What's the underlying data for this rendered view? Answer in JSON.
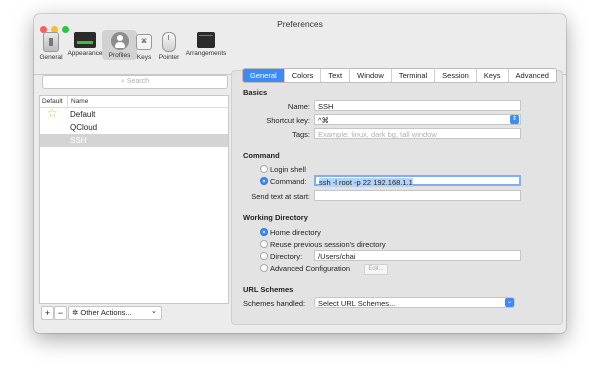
{
  "window": {
    "title": "Preferences"
  },
  "toolbar": {
    "items": [
      {
        "label": "General"
      },
      {
        "label": "Appearance"
      },
      {
        "label": "Profiles"
      },
      {
        "label": "Keys"
      },
      {
        "label": "Pointer"
      },
      {
        "label": "Arrangements"
      }
    ]
  },
  "profiles": {
    "search_placeholder": "Search",
    "col_default": "Default",
    "col_name": "Name",
    "rows": [
      {
        "name": "Default",
        "is_default": true
      },
      {
        "name": "QCloud",
        "is_default": false
      },
      {
        "name": "SSH",
        "is_default": false,
        "selected": true
      }
    ],
    "add_label": "+",
    "remove_label": "−",
    "other_actions_label": "Other Actions...",
    "other_actions_caret": "⌄",
    "gear": "✲"
  },
  "tabs": [
    {
      "label": "General",
      "active": true
    },
    {
      "label": "Colors"
    },
    {
      "label": "Text"
    },
    {
      "label": "Window"
    },
    {
      "label": "Terminal"
    },
    {
      "label": "Session"
    },
    {
      "label": "Keys"
    },
    {
      "label": "Advanced"
    }
  ],
  "basics": {
    "heading": "Basics",
    "name_label": "Name:",
    "name_value": "SSH",
    "shortcut_label": "Shortcut key:",
    "shortcut_value": "^⌘",
    "tags_label": "Tags:",
    "tags_placeholder": "Example: linux, dark bg, tall window"
  },
  "command": {
    "heading": "Command",
    "login_shell_label": "Login shell",
    "command_label": "Command:",
    "command_value": "ssh -l root -p 22 192.168.1.1",
    "send_text_label": "Send text at start:",
    "send_text_value": ""
  },
  "working_directory": {
    "heading": "Working Directory",
    "home_label": "Home directory",
    "reuse_label": "Reuse previous session's directory",
    "directory_label": "Directory:",
    "directory_value": "/Users/chai",
    "advanced_label": "Advanced Configuration",
    "edit_label": "Edit..."
  },
  "url_schemes": {
    "heading": "URL Schemes",
    "handled_label": "Schemes handled:",
    "select_value": "Select URL Schemes..."
  },
  "colors": {
    "accent": "#3d8bf5",
    "close": "#fc5f57",
    "minimize": "#fdbc2e",
    "zoom": "#28c840"
  }
}
